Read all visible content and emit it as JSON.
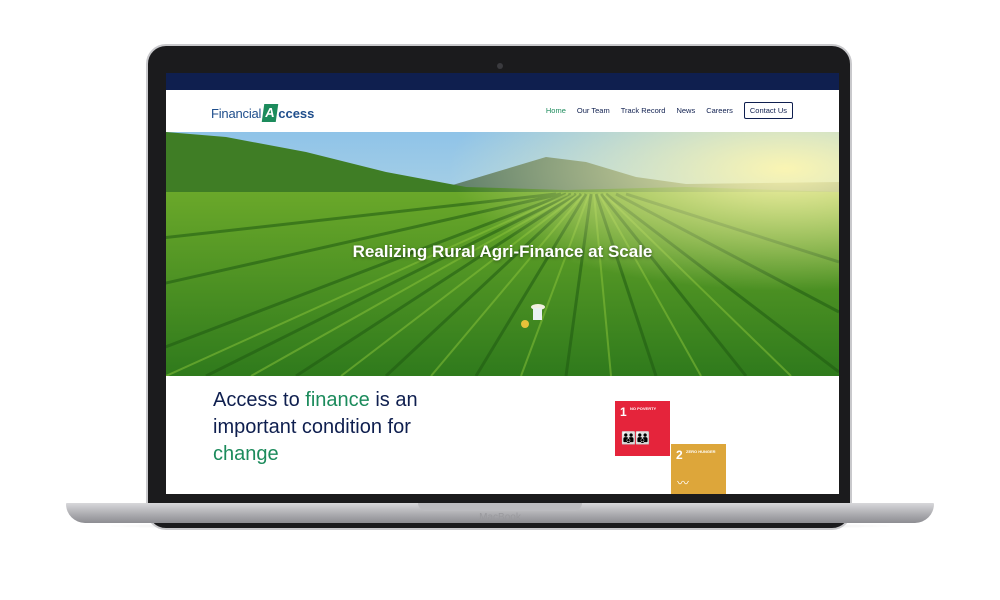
{
  "device": {
    "brand_label": "MacBook"
  },
  "site": {
    "logo": {
      "part1": "Financial",
      "badge": "A",
      "part2": "ccess"
    },
    "nav": {
      "items": [
        "Home",
        "Our Team",
        "Track Record",
        "News",
        "Careers"
      ],
      "contact_label": "Contact Us"
    },
    "hero": {
      "title": "Realizing Rural Agri-Finance at Scale"
    },
    "headline": {
      "p1": "Access to ",
      "p2": "finance",
      "p3": " is an important condition for ",
      "p4": "change"
    },
    "sdg_tiles": [
      {
        "number": "1",
        "label": "NO POVERTY",
        "icon": "family-icon",
        "color": "#e5243b"
      },
      {
        "number": "2",
        "label": "ZERO HUNGER",
        "icon": "bowl-icon",
        "color": "#dda63a"
      }
    ]
  },
  "colors": {
    "navy": "#0f1f4f",
    "green": "#1c8b5c",
    "brand_blue": "#1f4e8c"
  }
}
